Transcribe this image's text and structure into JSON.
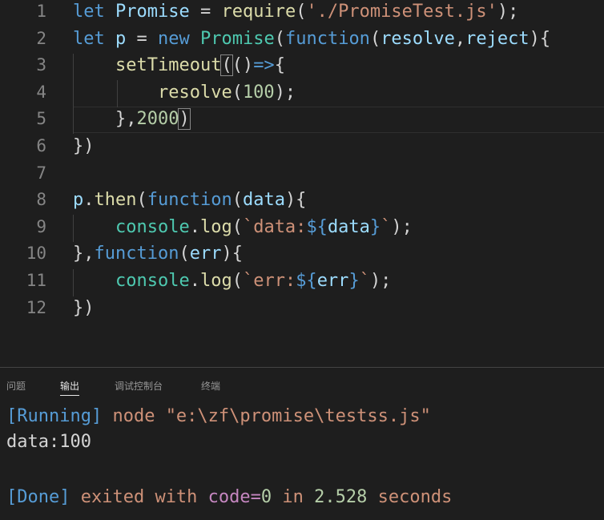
{
  "colors": {
    "background": "#1e1e1e",
    "line_number": "#858585",
    "keyword": "#569cd6",
    "variable": "#9cdcfe",
    "class": "#4ec9b0",
    "function": "#dcdcaa",
    "string": "#ce9178",
    "number": "#b5cea8",
    "punctuation": "#d4d4d4",
    "output_purple": "#c586c0"
  },
  "editor": {
    "lines": [
      {
        "number": "1",
        "tokens": [
          {
            "text": "let",
            "kind": "kw"
          },
          {
            "text": " ",
            "kind": "pun"
          },
          {
            "text": "Promise",
            "kind": "var"
          },
          {
            "text": " = ",
            "kind": "pun"
          },
          {
            "text": "require",
            "kind": "fn"
          },
          {
            "text": "(",
            "kind": "pun"
          },
          {
            "text": "'./PromiseTest.js'",
            "kind": "str"
          },
          {
            "text": ");",
            "kind": "pun"
          }
        ]
      },
      {
        "number": "2",
        "tokens": [
          {
            "text": "let",
            "kind": "kw"
          },
          {
            "text": " ",
            "kind": "pun"
          },
          {
            "text": "p",
            "kind": "var"
          },
          {
            "text": " = ",
            "kind": "pun"
          },
          {
            "text": "new",
            "kind": "kw"
          },
          {
            "text": " ",
            "kind": "pun"
          },
          {
            "text": "Promise",
            "kind": "cls"
          },
          {
            "text": "(",
            "kind": "pun"
          },
          {
            "text": "function",
            "kind": "kw"
          },
          {
            "text": "(",
            "kind": "pun"
          },
          {
            "text": "resolve",
            "kind": "var"
          },
          {
            "text": ",",
            "kind": "pun"
          },
          {
            "text": "reject",
            "kind": "var"
          },
          {
            "text": "){",
            "kind": "pun"
          }
        ]
      },
      {
        "number": "3",
        "tokens": [
          {
            "text": "    ",
            "kind": "pun"
          },
          {
            "text": "setTimeout",
            "kind": "fn"
          },
          {
            "text": "(",
            "kind": "pun",
            "highlight": true
          },
          {
            "text": "()",
            "kind": "pun"
          },
          {
            "text": "=>",
            "kind": "kw"
          },
          {
            "text": "{",
            "kind": "pun"
          }
        ]
      },
      {
        "number": "4",
        "tokens": [
          {
            "text": "        ",
            "kind": "pun"
          },
          {
            "text": "resolve",
            "kind": "fn"
          },
          {
            "text": "(",
            "kind": "pun"
          },
          {
            "text": "100",
            "kind": "num"
          },
          {
            "text": ");",
            "kind": "pun"
          }
        ]
      },
      {
        "number": "5",
        "tokens": [
          {
            "text": "    ",
            "kind": "pun"
          },
          {
            "text": "},",
            "kind": "pun"
          },
          {
            "text": "2000",
            "kind": "num"
          },
          {
            "text": ")",
            "kind": "pun",
            "highlight": true
          }
        ]
      },
      {
        "number": "6",
        "tokens": [
          {
            "text": "})",
            "kind": "pun"
          }
        ]
      },
      {
        "number": "7",
        "tokens": []
      },
      {
        "number": "8",
        "tokens": [
          {
            "text": "p",
            "kind": "var"
          },
          {
            "text": ".",
            "kind": "pun"
          },
          {
            "text": "then",
            "kind": "fn"
          },
          {
            "text": "(",
            "kind": "pun"
          },
          {
            "text": "function",
            "kind": "kw"
          },
          {
            "text": "(",
            "kind": "pun"
          },
          {
            "text": "data",
            "kind": "var"
          },
          {
            "text": "){",
            "kind": "pun"
          }
        ]
      },
      {
        "number": "9",
        "tokens": [
          {
            "text": "    ",
            "kind": "pun"
          },
          {
            "text": "console",
            "kind": "cls"
          },
          {
            "text": ".",
            "kind": "pun"
          },
          {
            "text": "log",
            "kind": "fn"
          },
          {
            "text": "(",
            "kind": "pun"
          },
          {
            "text": "`data:",
            "kind": "str"
          },
          {
            "text": "${",
            "kind": "kw"
          },
          {
            "text": "data",
            "kind": "var"
          },
          {
            "text": "}",
            "kind": "kw"
          },
          {
            "text": "`",
            "kind": "str"
          },
          {
            "text": ");",
            "kind": "pun"
          }
        ]
      },
      {
        "number": "10",
        "tokens": [
          {
            "text": "},",
            "kind": "pun"
          },
          {
            "text": "function",
            "kind": "kw"
          },
          {
            "text": "(",
            "kind": "pun"
          },
          {
            "text": "err",
            "kind": "var"
          },
          {
            "text": "){",
            "kind": "pun"
          }
        ]
      },
      {
        "number": "11",
        "tokens": [
          {
            "text": "    ",
            "kind": "pun"
          },
          {
            "text": "console",
            "kind": "cls"
          },
          {
            "text": ".",
            "kind": "pun"
          },
          {
            "text": "log",
            "kind": "fn"
          },
          {
            "text": "(",
            "kind": "pun"
          },
          {
            "text": "`err:",
            "kind": "str"
          },
          {
            "text": "${",
            "kind": "kw"
          },
          {
            "text": "err",
            "kind": "var"
          },
          {
            "text": "}",
            "kind": "kw"
          },
          {
            "text": "`",
            "kind": "str"
          },
          {
            "text": ");",
            "kind": "pun"
          }
        ]
      },
      {
        "number": "12",
        "tokens": [
          {
            "text": "})",
            "kind": "pun"
          }
        ]
      }
    ]
  },
  "panel": {
    "tabs": [
      {
        "label": "问题",
        "active": false
      },
      {
        "label": "输出",
        "active": true
      },
      {
        "label": "调试控制台",
        "active": false
      },
      {
        "label": "终端",
        "active": false
      }
    ],
    "output": {
      "running_tag": "[Running]",
      "command": " node \"e:\\zf\\promise\\testss.js\"",
      "data_line": "data:100",
      "done_tag": "[Done]",
      "exited_with": " exited with ",
      "code_label": "code=",
      "code_value": "0",
      "in_word": " in ",
      "duration": "2.528",
      "seconds": " seconds"
    }
  }
}
